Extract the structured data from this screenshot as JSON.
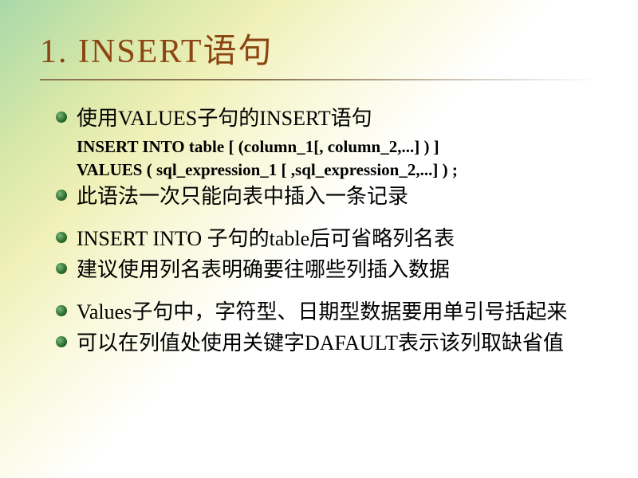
{
  "title": "1. INSERT语句",
  "bullets": {
    "b1": "使用VALUES子句的INSERT语句",
    "code1": "INSERT INTO table [ (column_1[, column_2,...] ) ]",
    "code2": " VALUES ( sql_expression_1 [ ,sql_expression_2,...] ) ;",
    "b2": "此语法一次只能向表中插入一条记录",
    "b3": "INSERT INTO 子句的table后可省略列名表",
    "b4": "建议使用列名表明确要往哪些列插入数据",
    "b5": "Values子句中，字符型、日期型数据要用单引号括起来",
    "b6": "可以在列值处使用关键字DAFAULT表示该列取缺省值"
  }
}
